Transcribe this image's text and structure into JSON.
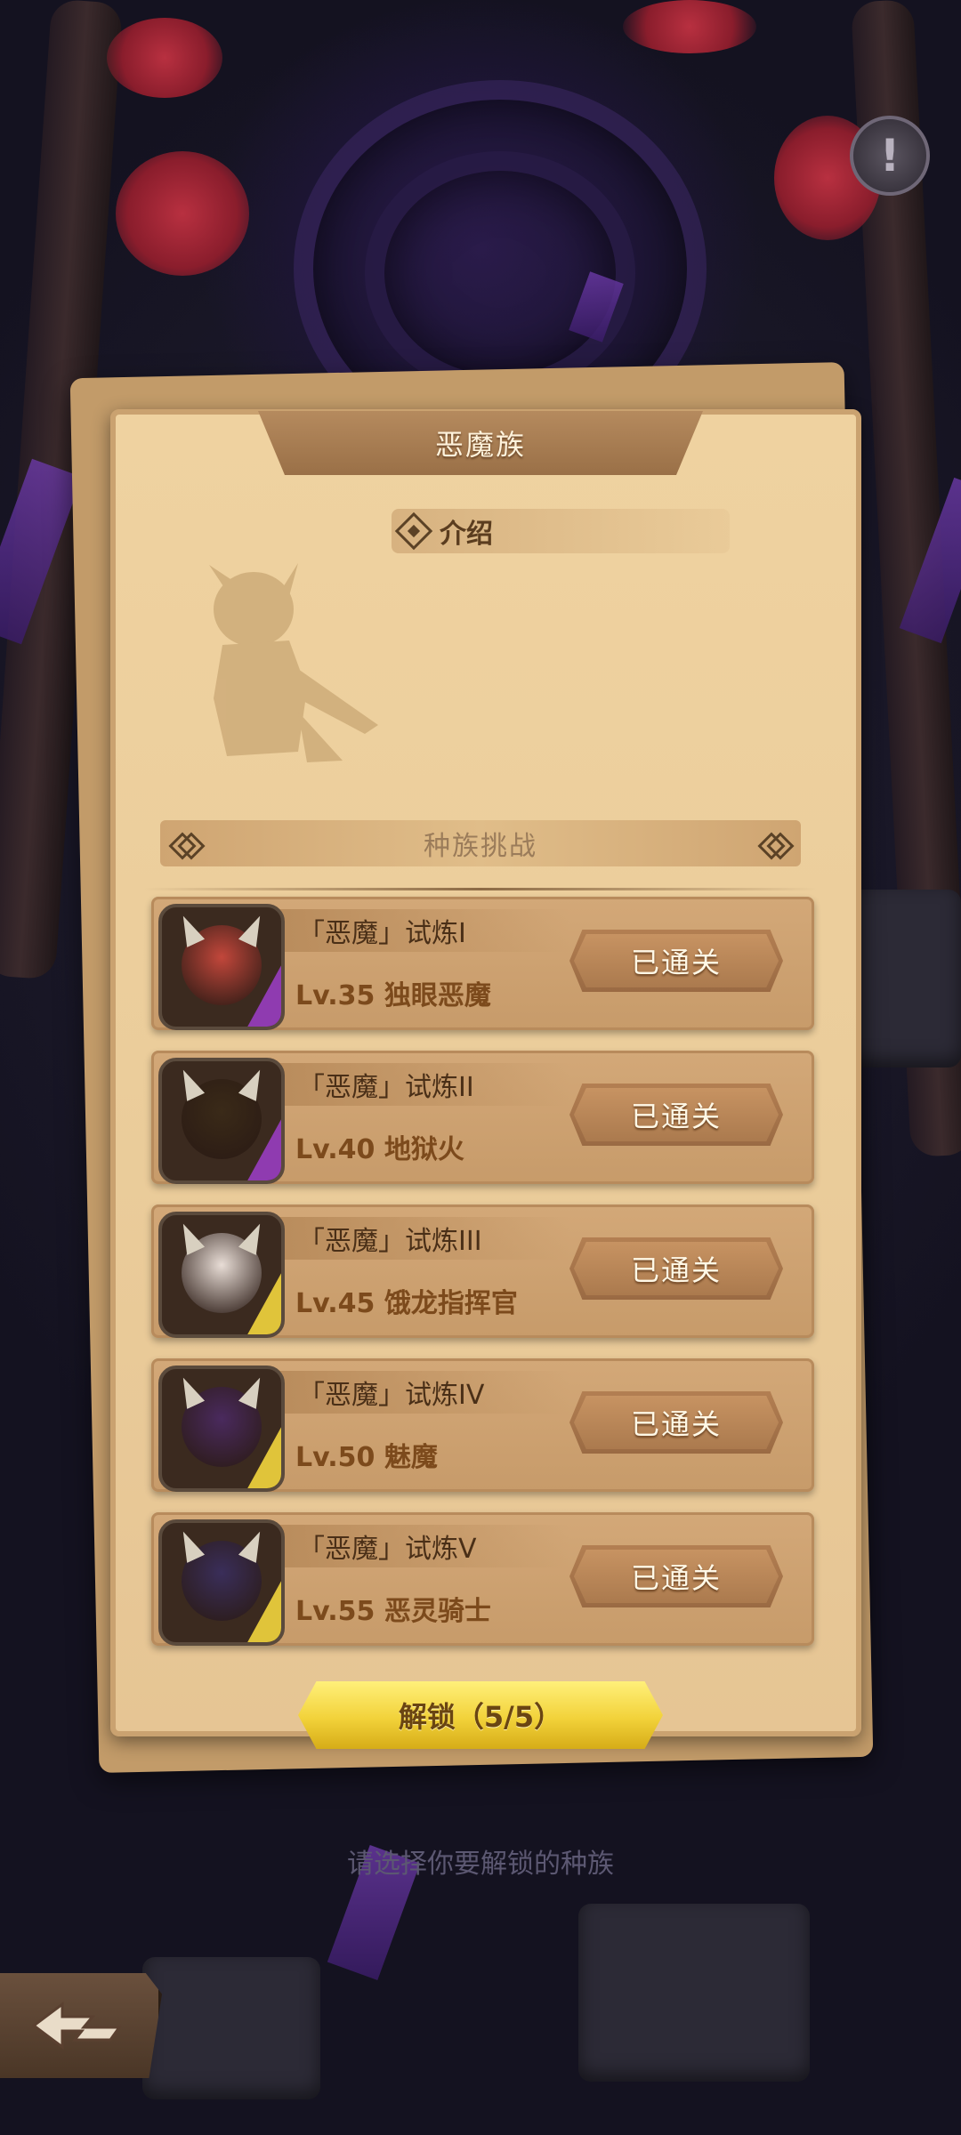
{
  "race": {
    "title": "恶魔族",
    "intro_label": "介绍",
    "challenge_header": "种族挑战"
  },
  "trials": [
    {
      "name": "「恶魔」试炼I",
      "level": "Lv.35 独眼恶魔",
      "status": "已通关",
      "portrait_color": "#c2473b",
      "frame_corner": "#8f3bb0"
    },
    {
      "name": "「恶魔」试炼II",
      "level": "Lv.40 地狱火",
      "status": "已通关",
      "portrait_color": "#3a2a18",
      "frame_corner": "#8f3bb0"
    },
    {
      "name": "「恶魔」试炼III",
      "level": "Lv.45 饿龙指挥官",
      "status": "已通关",
      "portrait_color": "#e8ddd6",
      "frame_corner": "#e0c43a"
    },
    {
      "name": "「恶魔」试炼IV",
      "level": "Lv.50 魅魔",
      "status": "已通关",
      "portrait_color": "#4a2a5e",
      "frame_corner": "#e0c43a"
    },
    {
      "name": "「恶魔」试炼V",
      "level": "Lv.55 恶灵骑士",
      "status": "已通关",
      "portrait_color": "#3a2e5a",
      "frame_corner": "#e0c43a"
    }
  ],
  "unlock_button": "解锁（5/5）",
  "hint": "请选择你要解锁的种族",
  "icons": {
    "info": "exclamation-icon",
    "back": "back-arrow-icon"
  }
}
